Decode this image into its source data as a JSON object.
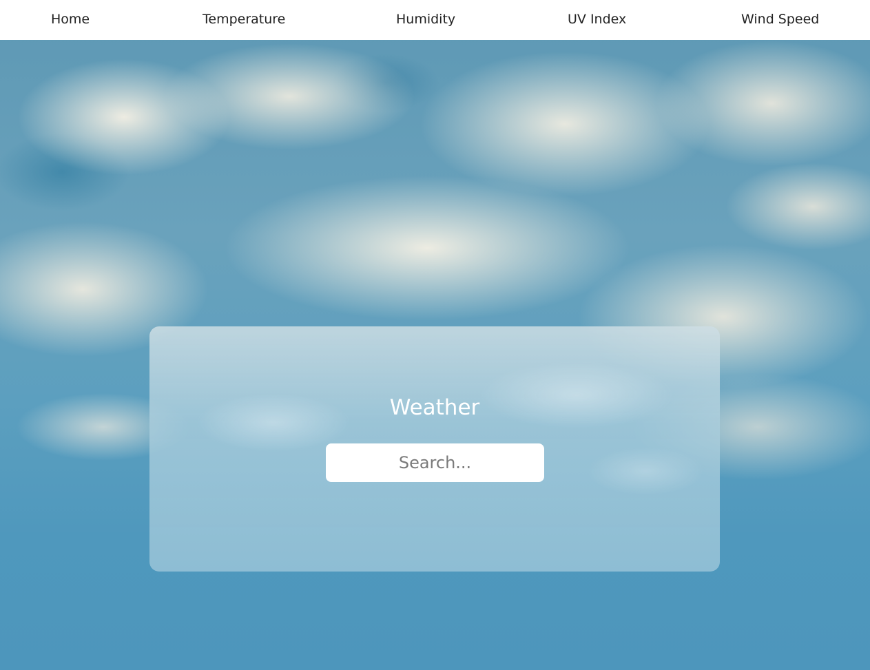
{
  "nav": {
    "items": [
      {
        "label": "Home"
      },
      {
        "label": "Temperature"
      },
      {
        "label": "Humidity"
      },
      {
        "label": "UV Index"
      },
      {
        "label": "Wind Speed"
      }
    ]
  },
  "card": {
    "title": "Weather",
    "search": {
      "value": "",
      "placeholder": "Search..."
    }
  },
  "colors": {
    "nav_background": "#ffffff",
    "nav_text": "#222222",
    "title_text": "#ffffff",
    "sky_blue": "#5c9fbf"
  }
}
